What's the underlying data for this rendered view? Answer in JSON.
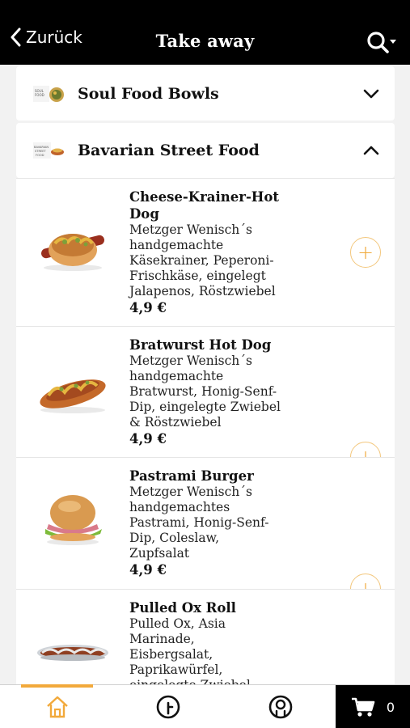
{
  "header": {
    "back_label": "Zurück",
    "title": "Take away"
  },
  "categories": [
    {
      "name": "Soul Food Bowls",
      "expanded": false
    },
    {
      "name": "Bavarian Street Food",
      "expanded": true
    }
  ],
  "items": [
    {
      "name_line1": "Cheese-Krainer-Hot",
      "name_line2": "Dog",
      "desc": [
        "Metzger Wenisch´s",
        "handgemachte",
        "Käsekrainer, Peperoni-",
        "Frischkäse, eingelegt",
        "Jalapenos, Röstzwiebel"
      ],
      "price": "4,9 €"
    },
    {
      "name_line1": "Bratwurst Hot Dog",
      "desc": [
        "Metzger Wenisch´s",
        "handgemachte",
        "Bratwurst, Honig-Senf-",
        "Dip, eingelegte Zwiebel",
        "& Röstzwiebel"
      ],
      "price": "4,9 €"
    },
    {
      "name_line1": "Pastrami Burger",
      "desc": [
        "Metzger Wenisch´s",
        "handgemachtes",
        "Pastrami, Honig-Senf-",
        "Dip, Coleslaw,",
        "Zupfsalat"
      ],
      "price": "4,9 €"
    },
    {
      "name_line1": "Pulled Ox Roll",
      "desc": [
        "Pulled Ox, Asia",
        "Marinade,",
        "Eisbergsalat,",
        "Paprikawürfel,",
        "eingelegte Zwiebel"
      ],
      "price": ""
    }
  ],
  "cart": {
    "count": "0"
  },
  "colors": {
    "accent": "#f2a93b",
    "header_bg": "#000000"
  },
  "icons": {
    "back": "chevron-left-icon",
    "search": "search-icon",
    "home": "home-icon",
    "orders": "clock-icon",
    "profile": "user-icon",
    "cart": "cart-icon"
  }
}
